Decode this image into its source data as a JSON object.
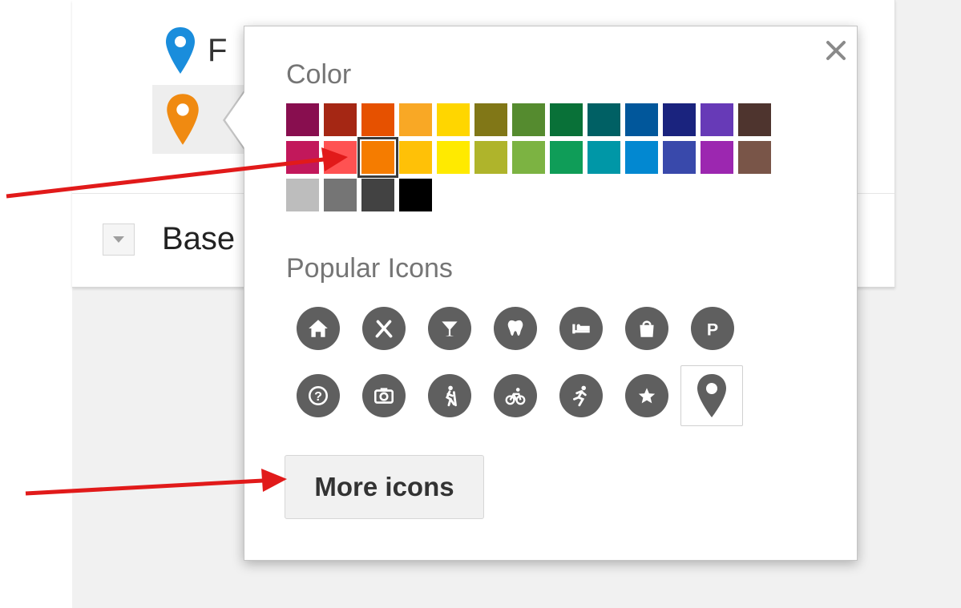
{
  "layers": {
    "first_row_label": "F",
    "base_label": "Base",
    "first_pin_color": "#1a8ddc",
    "second_pin_color": "#f08a11"
  },
  "popup": {
    "color_title": "Color",
    "icons_title": "Popular Icons",
    "close_label": "✕",
    "more_icons_label": "More icons",
    "selected_color": "#f57c00",
    "swatch_rows": [
      [
        "#880e4f",
        "#a52714",
        "#e65100",
        "#f9a825",
        "#ffd600",
        "#817717",
        "#558b2f",
        "#097138",
        "#006064",
        "#01579b",
        "#1a237e",
        "#673ab7",
        "#4e342e"
      ],
      [
        "#c2185b",
        "#ff5252",
        "#f57c00",
        "#ffc107",
        "#ffea00",
        "#afb42b",
        "#7cb342",
        "#0f9d58",
        "#0097a7",
        "#0288d1",
        "#3949ab",
        "#9c27b0",
        "#795548"
      ],
      [
        "#bdbdbd",
        "#757575",
        "#424242",
        "#000000"
      ]
    ],
    "icon_rows": [
      [
        "home-icon",
        "restaurant-icon",
        "bar-icon",
        "dentist-icon",
        "hotel-icon",
        "shopping-icon",
        "parking-icon"
      ],
      [
        "help-icon",
        "camera-icon",
        "hiking-icon",
        "cycling-icon",
        "running-icon",
        "star-icon",
        "location-pin-icon"
      ]
    ],
    "icon_color": "#5f5f5f"
  },
  "annotations": {
    "arrow_color": "#e11a1a"
  }
}
